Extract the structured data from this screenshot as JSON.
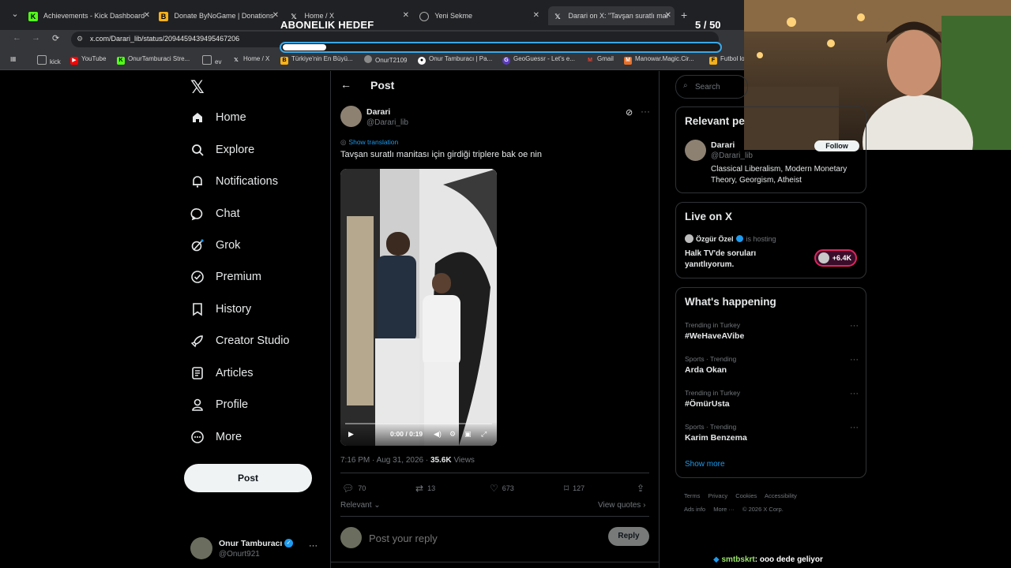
{
  "browser": {
    "tabs": [
      {
        "label": "Achievements - Kick Dashboard",
        "icon": "kick-icon"
      },
      {
        "label": "Donate ByNoGame | Donations",
        "icon": "bynogame-icon"
      },
      {
        "label": "Home / X",
        "icon": "x-icon"
      },
      {
        "label": "Yeni Sekme",
        "icon": "chrome-icon"
      },
      {
        "label": "Darari on X: \"Tavşan suratlı mar",
        "icon": "x-icon"
      }
    ],
    "url": "x.com/Darari_lib/status/2094459439495467206",
    "bookmarks": [
      "kick",
      "YouTube",
      "OnurTamburaci Stre...",
      "ev",
      "Home / X",
      "Türkiye'nin En Büyü...",
      "OnurT2109",
      "Onur Tamburacı | Pa...",
      "GeoGuessr - Let's e...",
      "Gmail",
      "Manowar.Magic.Cir...",
      "Futbol lo"
    ]
  },
  "overlay": {
    "goal_label": "ABONELIK HEDEF",
    "goal_count": "5 / 50",
    "goal_progress": 0.1,
    "chat_user": "smtbskrt",
    "chat_text": ": ooo dede geliyor"
  },
  "sidebar": {
    "items": [
      {
        "label": "Home",
        "icon": "home-icon"
      },
      {
        "label": "Explore",
        "icon": "search-icon"
      },
      {
        "label": "Notifications",
        "icon": "bell-icon"
      },
      {
        "label": "Chat",
        "icon": "chat-icon"
      },
      {
        "label": "Grok",
        "icon": "grok-icon"
      },
      {
        "label": "Premium",
        "icon": "premium-icon"
      },
      {
        "label": "History",
        "icon": "bookmark-icon"
      },
      {
        "label": "Creator Studio",
        "icon": "rocket-icon"
      },
      {
        "label": "Articles",
        "icon": "article-icon"
      },
      {
        "label": "Profile",
        "icon": "profile-icon"
      },
      {
        "label": "More",
        "icon": "more-circle-icon"
      }
    ],
    "post_label": "Post",
    "account": {
      "name": "Onur Tamburacı",
      "handle": "@Onurt921"
    }
  },
  "post": {
    "header_title": "Post",
    "author_name": "Darari",
    "author_handle": "@Darari_lib",
    "show_translation": "Show translation",
    "text": "Tavşan suratlı manitası için girdiği triplere bak oe nin",
    "video_time": "0:00 / 0:19",
    "timestamp": "7:16 PM · Aug 31, 2026 · ",
    "views_count": "35.6K",
    "views_label": "Views",
    "replies": "70",
    "reposts": "13",
    "likes": "673",
    "bookmarks": "127",
    "relevant_label": "Relevant",
    "view_quotes": "View quotes",
    "reply_placeholder": "Post your reply",
    "reply_button": "Reply"
  },
  "right": {
    "search_placeholder": "Search",
    "relevant_title": "Relevant pe",
    "relevant_person": {
      "name": "Darari",
      "handle": "@Darari_lib",
      "bio": "Classical Liberalism, Modern Monetary Theory, Georgism, Atheist",
      "follow_label": "Follow"
    },
    "live_title": "Live on X",
    "live": {
      "host_name": "Özgür Özel",
      "host_suffix": "is hosting",
      "title": "Halk TV'de soruları yanıtlıyorum.",
      "count": "+6.4K"
    },
    "happening_title": "What's happening",
    "trends": [
      {
        "meta": "Trending in Turkey",
        "name": "#WeHaveAVibe"
      },
      {
        "meta": "Sports · Trending",
        "name": "Arda Okan"
      },
      {
        "meta": "Trending in Turkey",
        "name": "#ÖmürUsta"
      },
      {
        "meta": "Sports · Trending",
        "name": "Karim Benzema"
      }
    ],
    "show_more": "Show more",
    "footer": [
      "Terms",
      "Privacy",
      "Cookies",
      "Accessibility",
      "Ads info",
      "More ···",
      "© 2026 X Corp."
    ]
  }
}
